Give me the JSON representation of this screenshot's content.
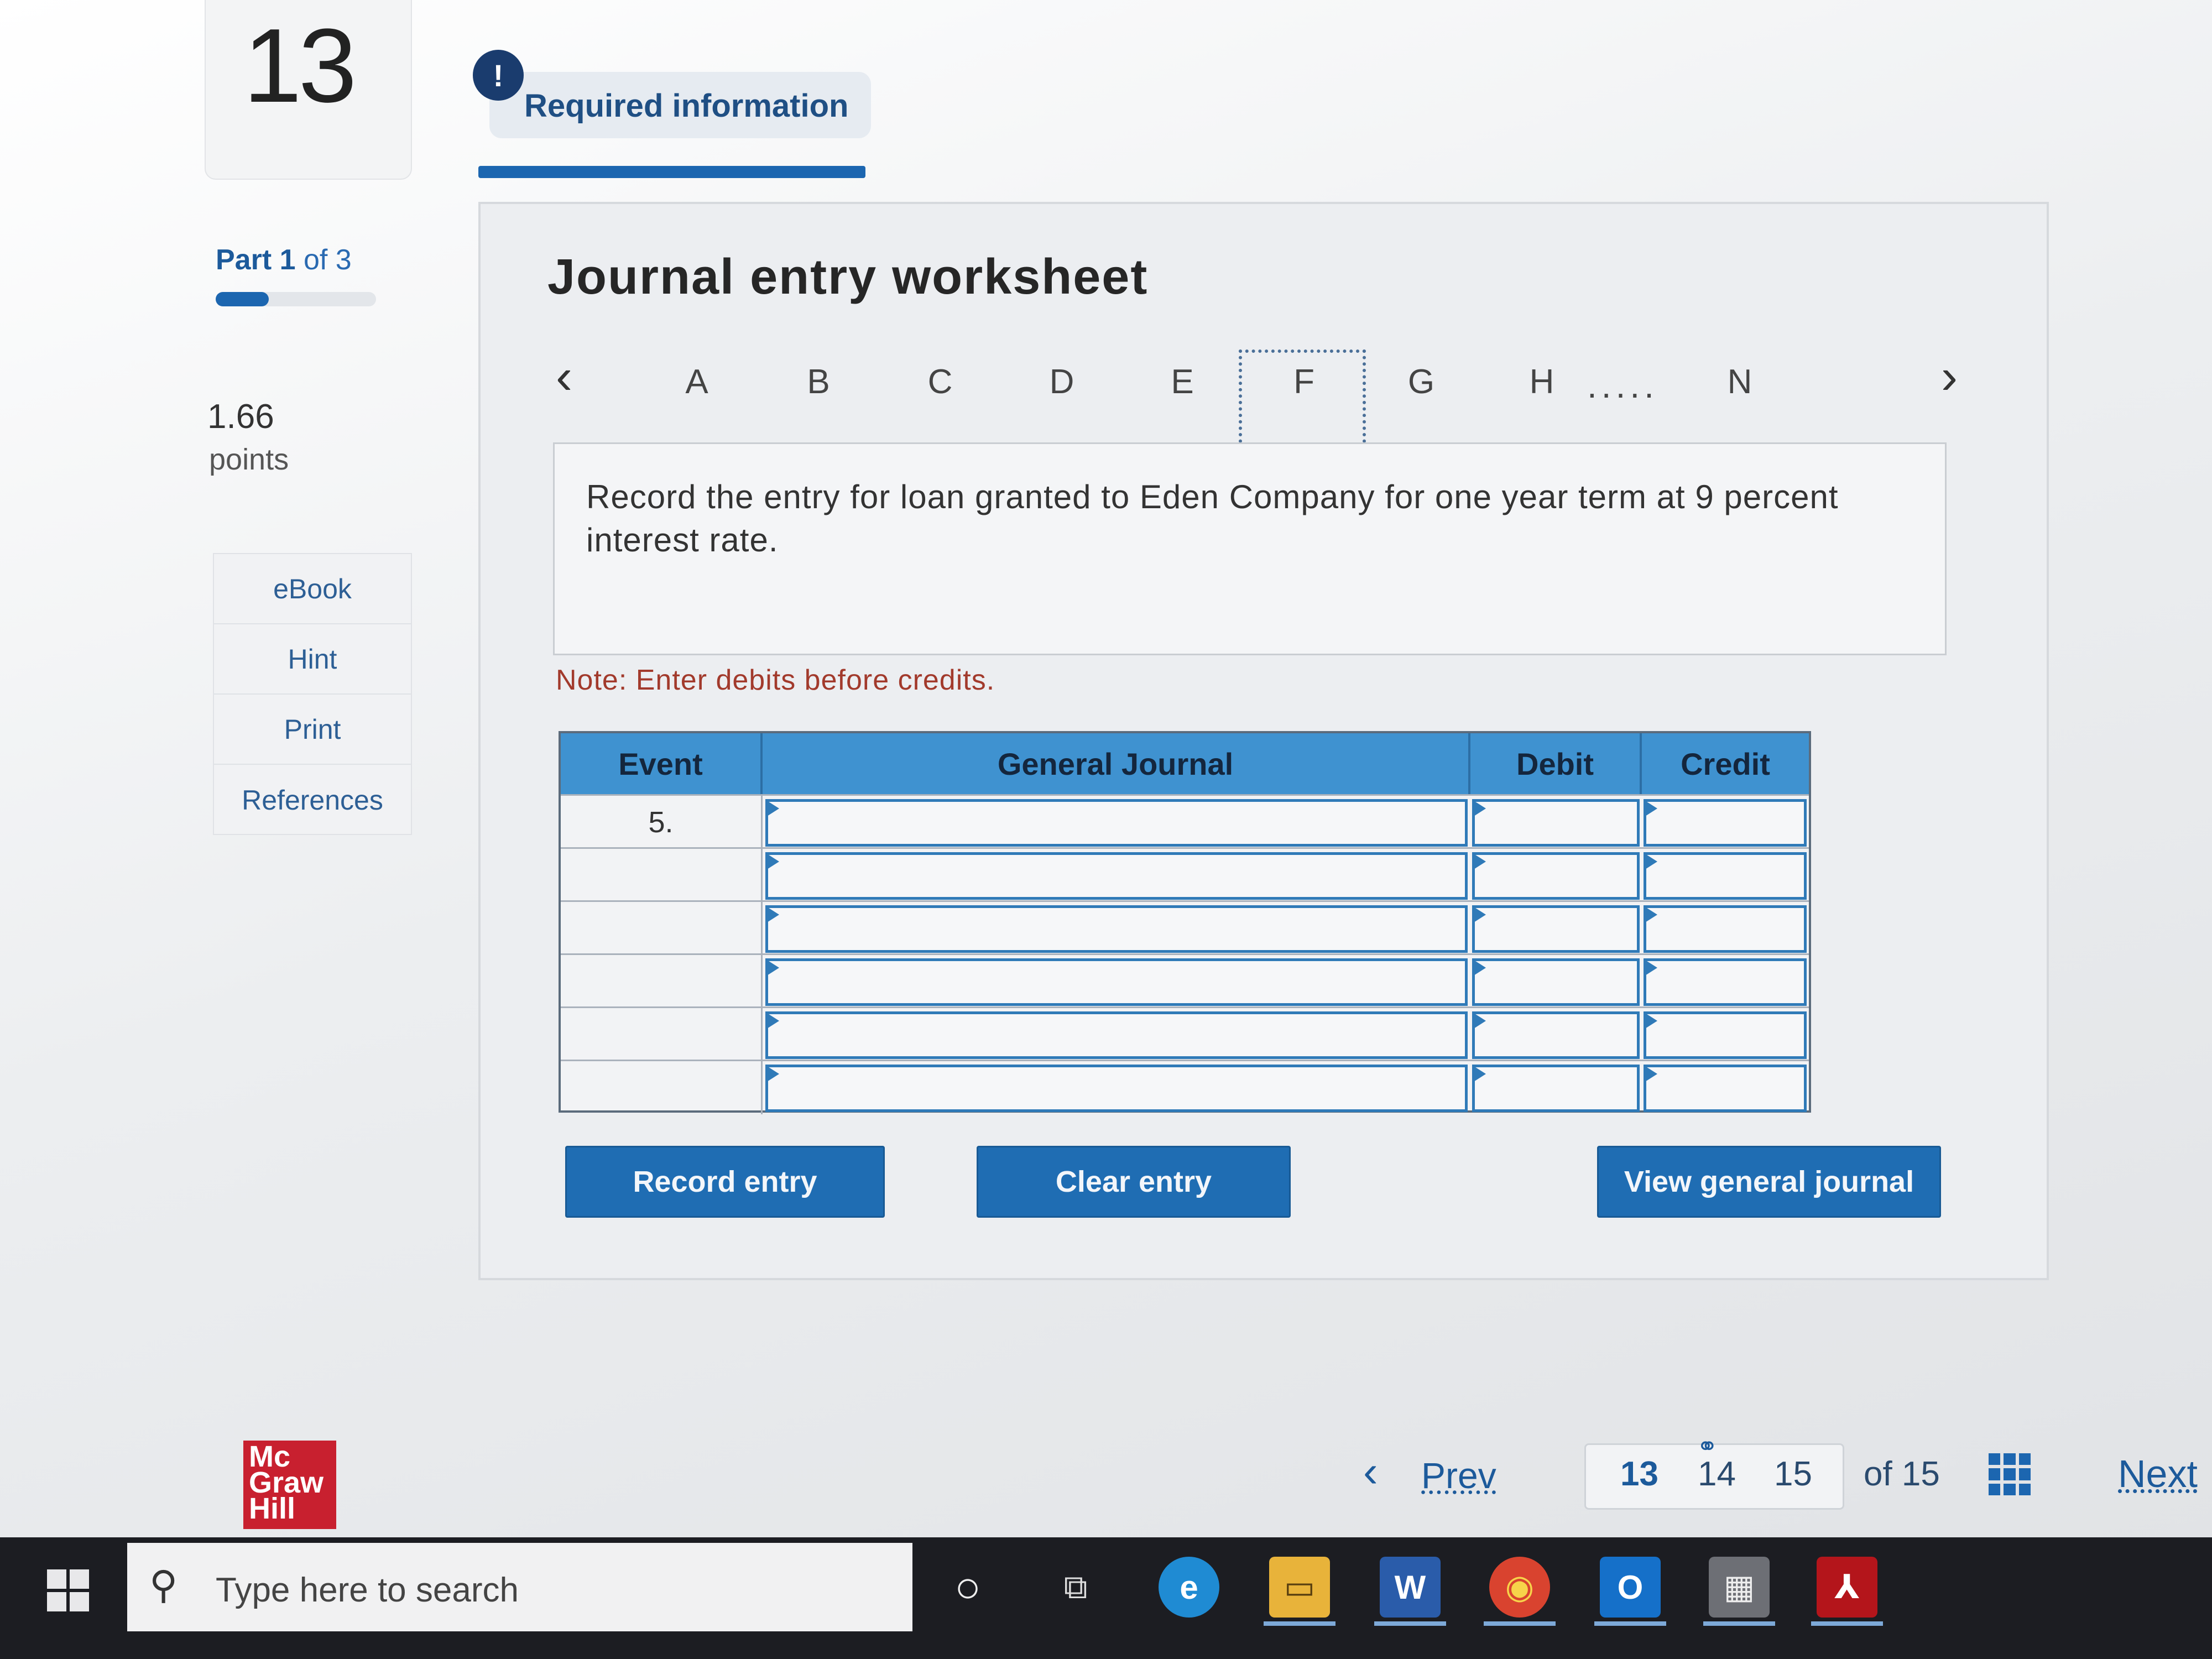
{
  "question": {
    "number": "13"
  },
  "required_info": {
    "icon_glyph": "!",
    "label": "Required information"
  },
  "part": {
    "prefix": "Part",
    "current": "1",
    "suffix": "of 3",
    "progress_fraction": 0.33
  },
  "points": {
    "value": "1.66",
    "label": "points"
  },
  "side_menu": [
    {
      "label": "eBook"
    },
    {
      "label": "Hint"
    },
    {
      "label": "Print"
    },
    {
      "label": "References"
    }
  ],
  "worksheet": {
    "title": "Journal entry worksheet",
    "prev_arrow": "‹",
    "next_arrow": "›",
    "tabs": [
      "A",
      "B",
      "C",
      "D",
      "E",
      "F",
      "G",
      "H",
      "N"
    ],
    "selected_tab": "F",
    "ellipsis": ".....",
    "instruction": "Record the entry for loan granted to Eden Company for one year term at 9 percent interest rate.",
    "note": "Note: Enter debits before credits."
  },
  "journal": {
    "headers": {
      "event": "Event",
      "general_journal": "General Journal",
      "debit": "Debit",
      "credit": "Credit"
    },
    "rows": [
      {
        "event": "5.",
        "account": "",
        "debit": "",
        "credit": ""
      },
      {
        "event": "",
        "account": "",
        "debit": "",
        "credit": ""
      },
      {
        "event": "",
        "account": "",
        "debit": "",
        "credit": ""
      },
      {
        "event": "",
        "account": "",
        "debit": "",
        "credit": ""
      },
      {
        "event": "",
        "account": "",
        "debit": "",
        "credit": ""
      },
      {
        "event": "",
        "account": "",
        "debit": "",
        "credit": ""
      }
    ]
  },
  "buttons": {
    "record": "Record entry",
    "clear": "Clear entry",
    "view": "View general journal"
  },
  "footer": {
    "logo_lines": [
      "Mc",
      "Graw",
      "Hill"
    ],
    "prev_arrow": "‹",
    "prev_label": "Prev",
    "pages": [
      "13",
      "14",
      "15"
    ],
    "current_page": "13",
    "link_icon_glyph": "⚭",
    "of_label": "of 15",
    "next_label": "Next"
  },
  "taskbar": {
    "search_icon_glyph": "⚲",
    "search_placeholder": "Type here to search",
    "apps": [
      {
        "name": "cortana-icon",
        "glyph": "○"
      },
      {
        "name": "task-view-icon",
        "glyph": "⧉"
      },
      {
        "name": "edge-icon",
        "glyph": "e"
      },
      {
        "name": "file-explorer-icon",
        "glyph": "▭"
      },
      {
        "name": "word-icon",
        "glyph": "W"
      },
      {
        "name": "chrome-icon",
        "glyph": "◉"
      },
      {
        "name": "outlook-icon",
        "glyph": "O"
      },
      {
        "name": "calculator-icon",
        "glyph": "▦"
      },
      {
        "name": "acrobat-icon",
        "glyph": "⅄"
      }
    ]
  },
  "colors": {
    "accent": "#1f6db3",
    "table_header": "#3f92d0",
    "note": "#a23a2c",
    "brand_red": "#c8202f"
  }
}
